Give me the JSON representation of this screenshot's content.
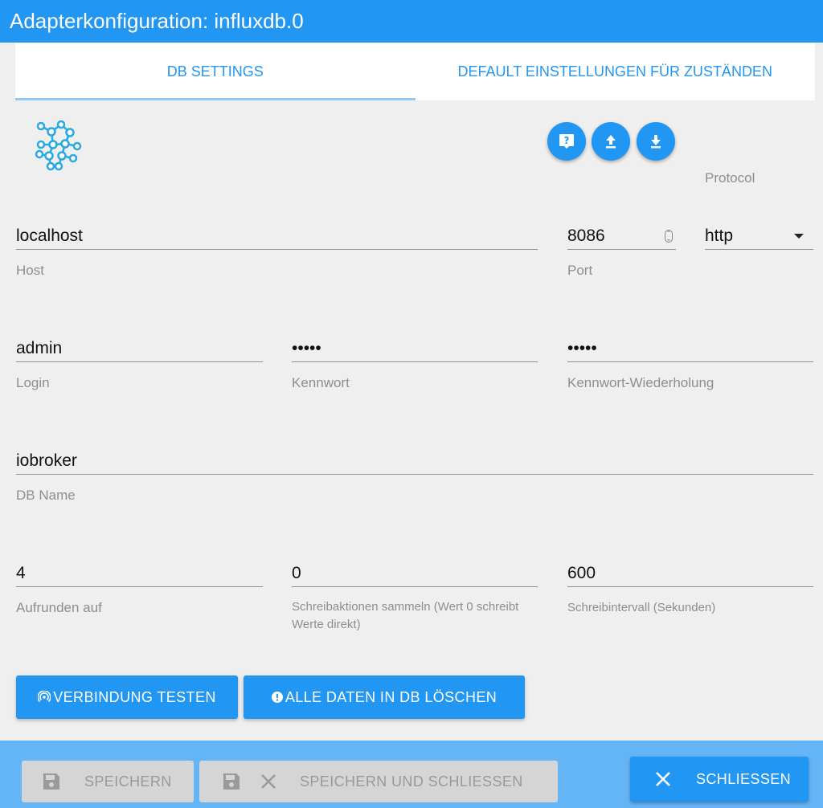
{
  "window": {
    "title": "Adapterkonfiguration: influxdb.0"
  },
  "tabs": [
    {
      "label": "DB SETTINGS",
      "active": true
    },
    {
      "label": "DEFAULT EINSTELLUNGEN FÜR ZUSTÄNDEN",
      "active": false
    }
  ],
  "toolbar": {
    "icons": [
      "help-icon",
      "upload-icon",
      "download-icon"
    ]
  },
  "form": {
    "host": {
      "value": "localhost",
      "label": "Host"
    },
    "port": {
      "value": "8086",
      "label": "Port"
    },
    "protocol": {
      "value": "http",
      "label": "Protocol"
    },
    "login": {
      "value": "admin",
      "label": "Login"
    },
    "password": {
      "value": "•••••",
      "label": "Kennwort"
    },
    "password_repeat": {
      "value": "•••••",
      "label": "Kennwort-Wiederholung"
    },
    "dbname": {
      "value": "iobroker",
      "label": "DB Name"
    },
    "round": {
      "value": "4",
      "label": "Aufrunden auf"
    },
    "collect": {
      "value": "0",
      "label": "Schreibaktionen sammeln (Wert 0 schreibt Werte direkt)"
    },
    "interval": {
      "value": "600",
      "label": "Schreibintervall (Sekunden)"
    }
  },
  "actions": {
    "test_connection": "VERBINDUNG TESTEN",
    "delete_all": "ALLE DATEN IN DB LÖSCHEN"
  },
  "footer": {
    "save": "SPEICHERN",
    "save_close": "SPEICHERN UND SCHLIESSEN",
    "close": "SCHLIESSEN"
  },
  "colors": {
    "primary": "#2196f3",
    "footer": "#64b5f6",
    "logo": "#29a9e1"
  }
}
